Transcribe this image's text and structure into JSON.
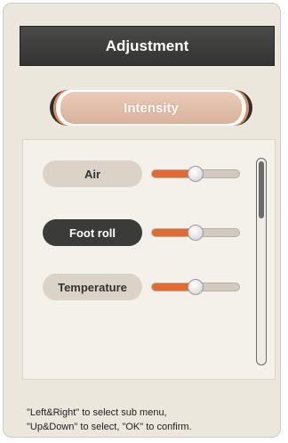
{
  "header": {
    "title": "Adjustment"
  },
  "tabs": [
    {
      "label": "Intensity",
      "selected": true
    }
  ],
  "items": [
    {
      "label": "Air",
      "value": 0.5,
      "selected": false
    },
    {
      "label": "Foot roll",
      "value": 0.5,
      "selected": true
    },
    {
      "label": "Temperature",
      "value": 0.5,
      "selected": false
    }
  ],
  "colors": {
    "slider_fill": "#e56a2f",
    "selected_item": "#3b3b39",
    "title_bar": "#3a3a38"
  },
  "scrollbar": {
    "position": 0
  },
  "hint": {
    "line1": "\"Left&Right\" to select sub menu,",
    "line2": "\"Up&Down\" to select, \"OK\" to confirm."
  }
}
